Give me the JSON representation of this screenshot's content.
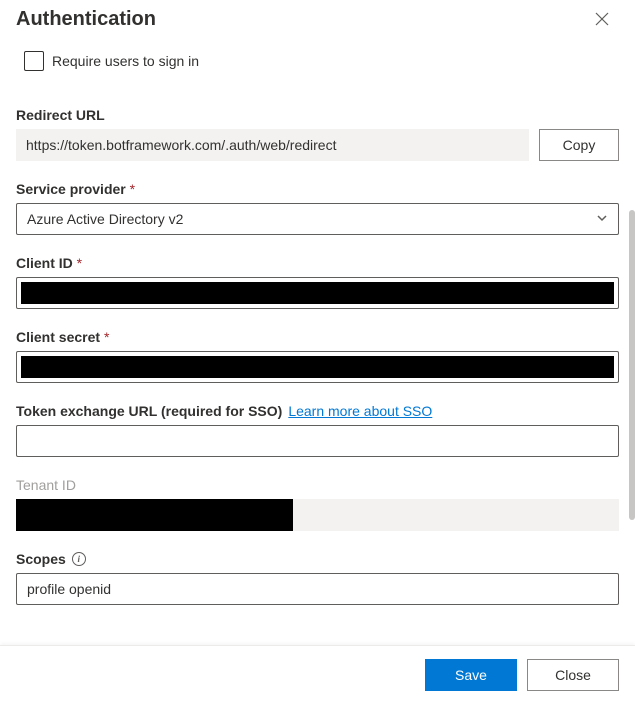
{
  "header": {
    "title": "Authentication"
  },
  "requireSignIn": {
    "label": "Require users to sign in",
    "checked": false
  },
  "redirectUrl": {
    "label": "Redirect URL",
    "value": "https://token.botframework.com/.auth/web/redirect",
    "copyLabel": "Copy"
  },
  "serviceProvider": {
    "label": "Service provider",
    "required": true,
    "value": "Azure Active Directory v2"
  },
  "clientId": {
    "label": "Client ID",
    "required": true,
    "value": "████████████████████████████████████"
  },
  "clientSecret": {
    "label": "Client secret",
    "required": true,
    "value": "████████████████████████████████████"
  },
  "tokenExchange": {
    "label": "Token exchange URL (required for SSO)",
    "linkText": "Learn more about SSO",
    "value": ""
  },
  "tenantId": {
    "label": "Tenant ID",
    "value": "████████████████"
  },
  "scopes": {
    "label": "Scopes",
    "value": "profile openid"
  },
  "footer": {
    "save": "Save",
    "close": "Close"
  }
}
